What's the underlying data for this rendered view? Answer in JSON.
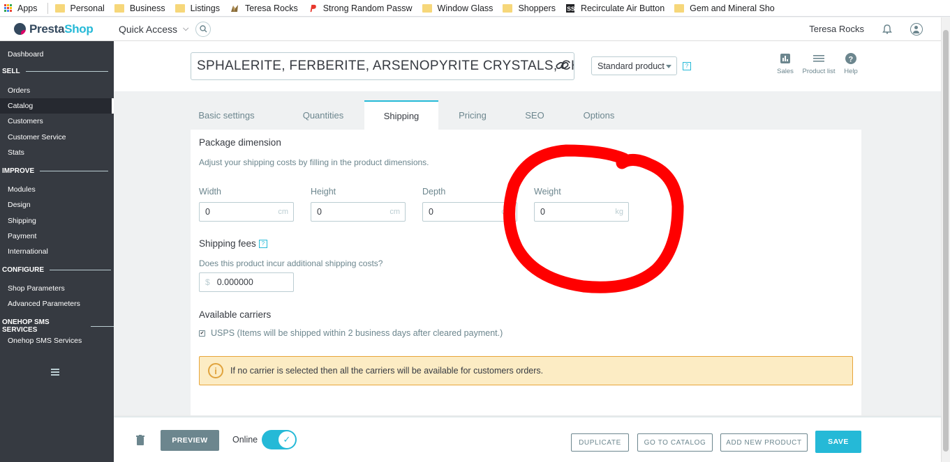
{
  "bookmarks": [
    {
      "label": "Apps",
      "icon": "apps-grid-icon"
    },
    {
      "label": "Personal",
      "icon": "folder-icon"
    },
    {
      "label": "Business",
      "icon": "folder-icon"
    },
    {
      "label": "Listings",
      "icon": "folder-icon"
    },
    {
      "label": "Teresa Rocks",
      "icon": "mineral-icon"
    },
    {
      "label": "Strong Random Passw",
      "icon": "password-site-icon"
    },
    {
      "label": "Window Glass",
      "icon": "folder-icon"
    },
    {
      "label": "Shoppers",
      "icon": "folder-icon"
    },
    {
      "label": "Recirculate Air Button",
      "icon": "ss-site-icon"
    },
    {
      "label": "Gem and Mineral Sho",
      "icon": "folder-icon"
    }
  ],
  "header": {
    "logo_text_a": "Presta",
    "logo_text_b": "Shop",
    "quick_access": "Quick Access",
    "user_name": "Teresa Rocks"
  },
  "sidebar": {
    "dashboard": "Dashboard",
    "sections": [
      {
        "title": "SELL",
        "items": [
          "Orders",
          "Catalog",
          "Customers",
          "Customer Service",
          "Stats"
        ]
      },
      {
        "title": "IMPROVE",
        "items": [
          "Modules",
          "Design",
          "Shipping",
          "Payment",
          "International"
        ]
      },
      {
        "title": "CONFIGURE",
        "items": [
          "Shop Parameters",
          "Advanced Parameters"
        ]
      },
      {
        "title": "ONEHOP SMS SERVICES",
        "items": [
          "Onehop SMS Services"
        ]
      }
    ],
    "active_item": "Catalog"
  },
  "product": {
    "name": "SPHALERITE, FERBERITE, ARSENOPYRITE CRYSTALS, CHALCO",
    "type": "Standard product",
    "help_glyph": "?"
  },
  "toolbar": {
    "sales": "Sales",
    "product_list": "Product list",
    "help": "Help"
  },
  "tabs": [
    "Basic settings",
    "Quantities",
    "Shipping",
    "Pricing",
    "SEO",
    "Options"
  ],
  "active_tab": "Shipping",
  "shipping": {
    "package_title": "Package dimension",
    "package_subtitle": "Adjust your shipping costs by filling in the product dimensions.",
    "dimensions": [
      {
        "label": "Width",
        "value": "0",
        "unit": "cm"
      },
      {
        "label": "Height",
        "value": "0",
        "unit": "cm"
      },
      {
        "label": "Depth",
        "value": "0",
        "unit": "cm"
      },
      {
        "label": "Weight",
        "value": "0",
        "unit": "kg"
      }
    ],
    "fees_title": "Shipping fees",
    "fees_question": "Does this product incur additional shipping costs?",
    "fees_currency": "$",
    "fees_value": "0.000000",
    "carriers_title": "Available carriers",
    "carrier_label": "USPS (Items will be shipped within 2 business days after cleared payment.)",
    "carrier_checked": true,
    "alert_text": "If no carrier is selected then all the carriers will be available for customers orders."
  },
  "footer": {
    "preview": "PREVIEW",
    "online_label": "Online",
    "online": true,
    "duplicate": "DUPLICATE",
    "go_to_catalog": "GO TO CATALOG",
    "add_new_product": "ADD NEW PRODUCT",
    "save": "SAVE"
  },
  "colors": {
    "accent": "#25b9d7",
    "sidebar_bg": "#363a41",
    "annotation": "#ff0000",
    "alert_bg": "#fcecc4"
  }
}
